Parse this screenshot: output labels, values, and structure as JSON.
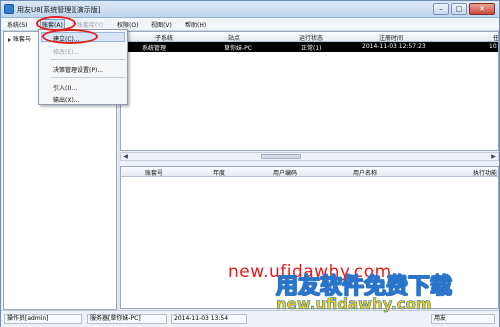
{
  "window": {
    "title": "用友U8[系统管理][演示版]",
    "controls": {
      "minimize": "–",
      "maximize": "□",
      "close": "✕"
    }
  },
  "menu": [
    {
      "label": "系统(S)",
      "state": "normal"
    },
    {
      "label": "账套(A)",
      "state": "active"
    },
    {
      "label": "账套库(Y)",
      "state": "disabled"
    },
    {
      "label": "权限(O)",
      "state": "normal"
    },
    {
      "label": "视图(V)",
      "state": "normal"
    },
    {
      "label": "帮助(H)",
      "state": "normal"
    }
  ],
  "dropdown": [
    {
      "label": "建立(C)...",
      "state": "highlighted"
    },
    {
      "label": "修改(E)...",
      "state": "disabled"
    },
    {
      "label": "决策管理设置(P)...",
      "state": "normal"
    },
    {
      "label": "引入(I)...",
      "state": "normal"
    },
    {
      "label": "输出(X)...",
      "state": "normal"
    }
  ],
  "tree": {
    "root_label": "账套与"
  },
  "top_table": {
    "columns": [
      "子系统",
      "站点",
      "运行状态",
      "注册时间",
      "任"
    ],
    "rows": [
      {
        "subsystem": "系统管理",
        "site": "草你妹-PC",
        "status": "正常(1)",
        "time": "2014-11-03 12:57:23",
        "task": "10"
      }
    ]
  },
  "bottom_table": {
    "columns": [
      "账套号",
      "年度",
      "用户编码",
      "用户名称",
      "执行功能"
    ]
  },
  "status": {
    "operator": "操作员[admin]",
    "server": "服务器[草你妹-PC]",
    "datetime": "2014-11-03 13:54",
    "extra": "用友"
  },
  "watermark": {
    "url_red": "new.ufidawhy.com",
    "slogan": "用友软件免费下载",
    "url_yellow": "new.ufidawhy.com"
  },
  "colors": {
    "annotation_circle": "#e0201a",
    "selection_row": "#000000"
  },
  "icons": {
    "app": "app-icon",
    "tree_expand": "triangle-right-icon"
  }
}
